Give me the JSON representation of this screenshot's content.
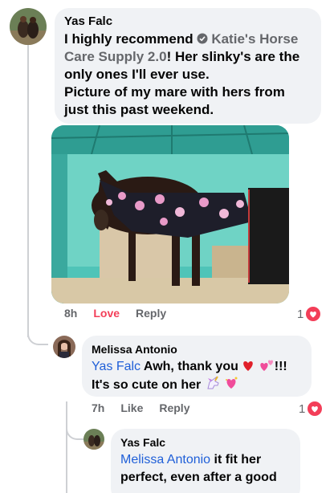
{
  "comment1": {
    "author": "Yas Falc",
    "mention": "Katie's Horse Care Supply 2.0",
    "text_before": "I highly recommend",
    "text_after": "! Her slinky's are the only ones I'll ever use.",
    "text_line2": "Picture of my mare with hers from just this past weekend.",
    "time": "8h",
    "love_label": "Love",
    "reply_label": "Reply",
    "reaction_count": "1"
  },
  "reply1": {
    "author": "Melissa Antonio",
    "mention": "Yas Falc",
    "text": "Awh, thank you",
    "text_after": "!!!",
    "text_line2": "It's so cute on her",
    "time": "7h",
    "like_label": "Like",
    "reply_label": "Reply",
    "reaction_count": "1"
  },
  "reply2": {
    "author": "Yas Falc",
    "mention": "Melissa Antonio",
    "text": "it fit her",
    "text_line2": "perfect, even after a good"
  },
  "colors": {
    "love": "#f33e58",
    "mention_blue": "#1f5fd8",
    "bubble": "#f0f2f5",
    "meta_grey": "#65676b"
  },
  "icons": [
    "verified-icon",
    "heart-icon",
    "heart-emoji",
    "two-hearts-emoji",
    "unicorn-emoji",
    "sparkling-heart-emoji"
  ]
}
